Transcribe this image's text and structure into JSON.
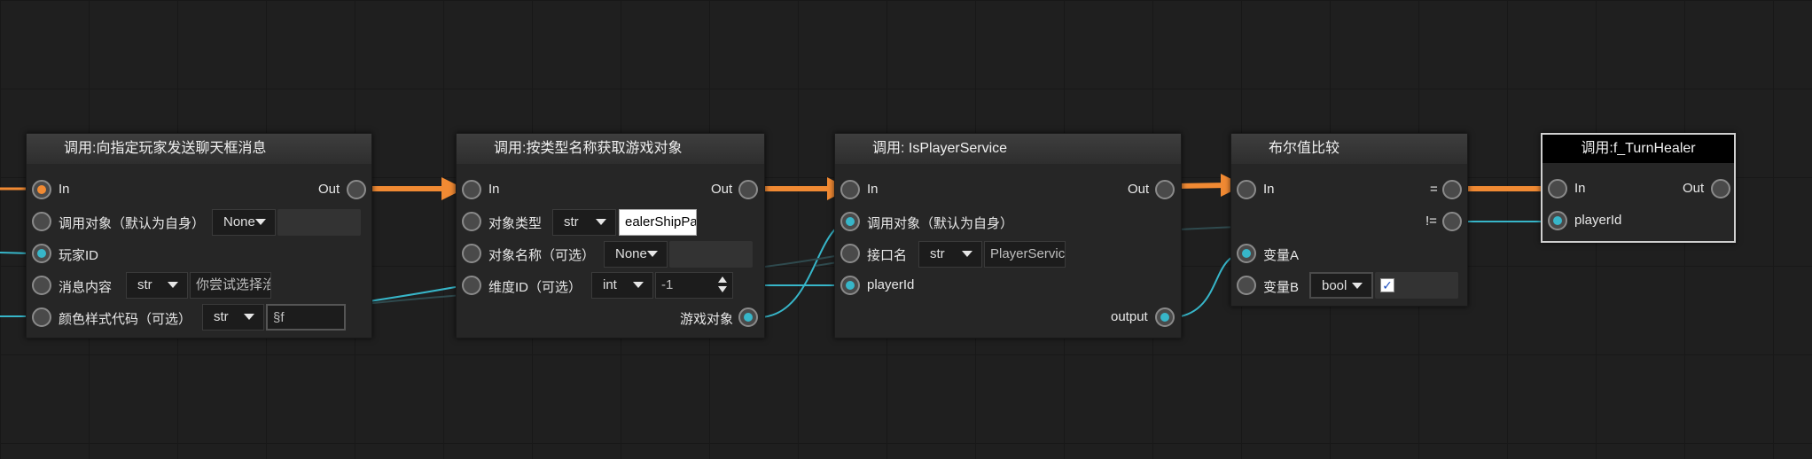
{
  "nodes": {
    "send_chat": {
      "title": "调用:向指定玩家发送聊天框消息",
      "in_label": "In",
      "out_label": "Out",
      "call_target_label": "调用对象（默认为自身）",
      "call_target_value": "None",
      "player_id_label": "玩家ID",
      "message_label": "消息内容",
      "message_type": "str",
      "message_value": "你尝试选择治",
      "color_label": "颜色样式代码（可选）",
      "color_type": "str",
      "color_value": "§f"
    },
    "get_object": {
      "title": "调用:按类型名称获取游戏对象",
      "in_label": "In",
      "out_label": "Out",
      "type_label": "对象类型",
      "type_type": "str",
      "type_value": "ealerShipPart",
      "name_label": "对象名称（可选）",
      "name_value": "None",
      "dim_label": "维度ID（可选）",
      "dim_type": "int",
      "dim_value": "-1",
      "output_label": "游戏对象"
    },
    "is_player_service": {
      "title": "调用: IsPlayerService",
      "in_label": "In",
      "out_label": "Out",
      "call_target_label": "调用对象（默认为自身）",
      "interface_label": "接口名",
      "interface_type": "str",
      "interface_value": "PlayerService",
      "player_id_label": "playerId",
      "output_label": "output"
    },
    "bool_compare": {
      "title": "布尔值比较",
      "in_label": "In",
      "eq_label": "=",
      "neq_label": "!=",
      "var_a_label": "变量A",
      "var_b_label": "变量B",
      "var_b_type": "bool",
      "var_b_checked": "✓"
    },
    "turn_healer": {
      "title": "调用:f_TurnHealer",
      "in_label": "In",
      "out_label": "Out",
      "player_id_label": "playerId"
    }
  },
  "colors": {
    "exec_wire": "#f18a33",
    "data_wire": "#37b6c9",
    "background": "#1f1f1f"
  }
}
